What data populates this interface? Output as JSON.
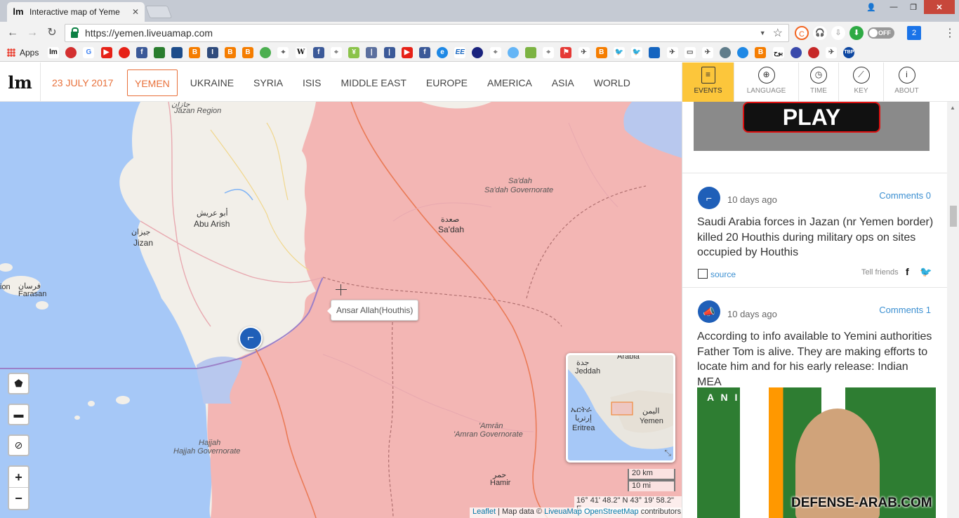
{
  "browser": {
    "tab_title": "Interactive map of Yeme",
    "url": "https://yemen.liveuamap.com",
    "apps_label": "Apps",
    "extension_toggle": "OFF",
    "extension_badge": "2"
  },
  "header": {
    "logo": "lm",
    "date": "23 JULY 2017",
    "nav": [
      "YEMEN",
      "UKRAINE",
      "SYRIA",
      "ISIS",
      "MIDDLE EAST",
      "EUROPE",
      "AMERICA",
      "ASIA",
      "WORLD"
    ],
    "buttons": {
      "events": "EVENTS",
      "language": "LANGUAGE",
      "time": "TIME",
      "key": "KEY",
      "about": "ABOUT"
    }
  },
  "map": {
    "colors": {
      "sea": "#a6c8f7",
      "land": "#f2efe9",
      "controlled": "#f3b6b4",
      "border": "#ea7a56"
    },
    "places": {
      "jazan_ar": "جازان",
      "jazan_region": "Jazan Region",
      "abu_arish_ar": "أبو عريش",
      "abu_arish": "Abu Arish",
      "jizan_ar": "جيزان",
      "jizan": "Jizan",
      "farasan_ar": "فرسان",
      "farasan": "Farasan",
      "ion": "ion",
      "sadah_gov_1": "Sa'dah",
      "sadah_gov_2": "Sa'dah Governorate",
      "sadah_ar": "صعدة",
      "sadah": "Sa'dah",
      "hajjah_1": "Hajjah",
      "hajjah_2": "Hajjah Governorate",
      "amran_1": "'Amrān",
      "amran_2": "'Amran Governorate",
      "hamir_ar": "حمر",
      "hamir": "Hamir"
    },
    "tooltip": "Ansar Allah(Houthis)",
    "minimap": {
      "jeddah_ar": "جدة",
      "jeddah": "Jeddah",
      "arabia": "Arabia",
      "eritrea_geez": "ኤርትራ",
      "eritrea_ar": "إرتريا",
      "eritrea": "Eritrea",
      "yemen_ar": "اليمن",
      "yemen": "Yemen"
    },
    "scale_km": "20 km",
    "scale_mi": "10 mi",
    "coords": "16° 41' 48.2\" N 43° 19' 58.2\" E",
    "attribution": {
      "leaflet": "Leaflet",
      "mid": " | Map data © ",
      "liveuamap": "LiveuaMap",
      "osm": "OpenStreetMap",
      "end": " contributors"
    },
    "zoom_in": "+",
    "zoom_out": "−"
  },
  "feed": {
    "top_image_label": "PLAY",
    "items": [
      {
        "time": "10 days ago",
        "comments": "Comments 0",
        "text": "Saudi Arabia forces in Jazan (nr Yemen border) killed 20 Houthis during military ops on sites occupied by Houthis",
        "source": "source",
        "tell": "Tell friends"
      },
      {
        "time": "10 days ago",
        "comments": "Comments 1",
        "text": "According to info available to Yemini authorities Father Tom is alive. They are making efforts to locate him and for his early release: Indian MEA"
      }
    ],
    "image_caption": "A N I"
  },
  "watermark": "DEFENSE-ARAB.COM"
}
